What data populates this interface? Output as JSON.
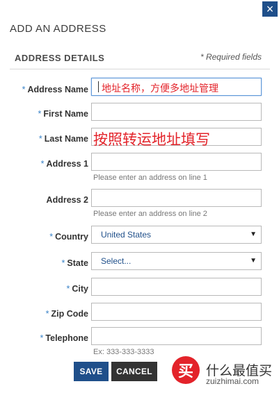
{
  "modal": {
    "close_icon": "×",
    "title": "ADD AN ADDRESS"
  },
  "section": {
    "title": "ADDRESS DETAILS",
    "required_note": "* Required fields"
  },
  "required_mark": "*",
  "fields": {
    "address_name": {
      "label": "Address Name",
      "required": true,
      "value": "",
      "overlay": "地址名称，方便多地址管理"
    },
    "first_name": {
      "label": "First Name",
      "required": true,
      "value": ""
    },
    "last_name": {
      "label": "Last Name",
      "required": true,
      "value": "",
      "overlay": "按照转运地址填写"
    },
    "address1": {
      "label": "Address 1",
      "required": true,
      "value": "",
      "hint": "Please enter an address on line 1"
    },
    "address2": {
      "label": "Address 2",
      "required": false,
      "value": "",
      "hint": "Please enter an address on line 2"
    },
    "country": {
      "label": "Country",
      "required": true,
      "selected": "United States"
    },
    "state": {
      "label": "State",
      "required": true,
      "selected": "Select..."
    },
    "city": {
      "label": "City",
      "required": true,
      "value": ""
    },
    "zip": {
      "label": "Zip Code",
      "required": true,
      "value": ""
    },
    "telephone": {
      "label": "Telephone",
      "required": true,
      "value": "",
      "hint": "Ex: 333-333-3333"
    }
  },
  "buttons": {
    "save": "SAVE",
    "cancel": "CANCEL"
  },
  "watermark": {
    "logo_char": "买",
    "name": "什么最值买",
    "url": "zuizhimai.com"
  },
  "colors": {
    "accent": "#1f4f8a",
    "required": "#3a83c8",
    "overlay_red": "#e3232a"
  }
}
